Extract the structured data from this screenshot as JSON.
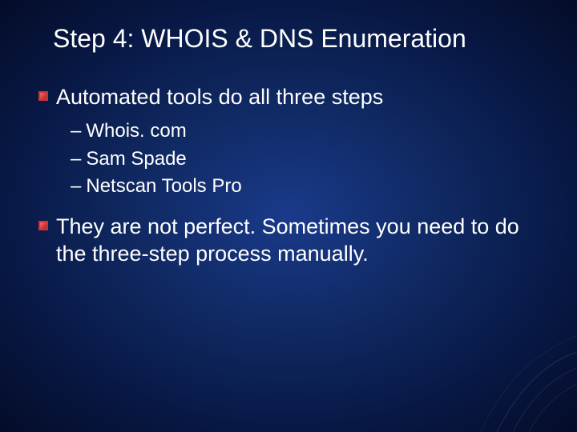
{
  "slide": {
    "title": "Step 4: WHOIS & DNS Enumeration",
    "bullets": [
      {
        "text": "Automated tools do all three steps",
        "subitems": [
          "Whois. com",
          "Sam Spade",
          "Netscan Tools Pro"
        ]
      },
      {
        "text": "They are not perfect.  Sometimes you need to do the three-step process manually.",
        "subitems": []
      }
    ]
  }
}
